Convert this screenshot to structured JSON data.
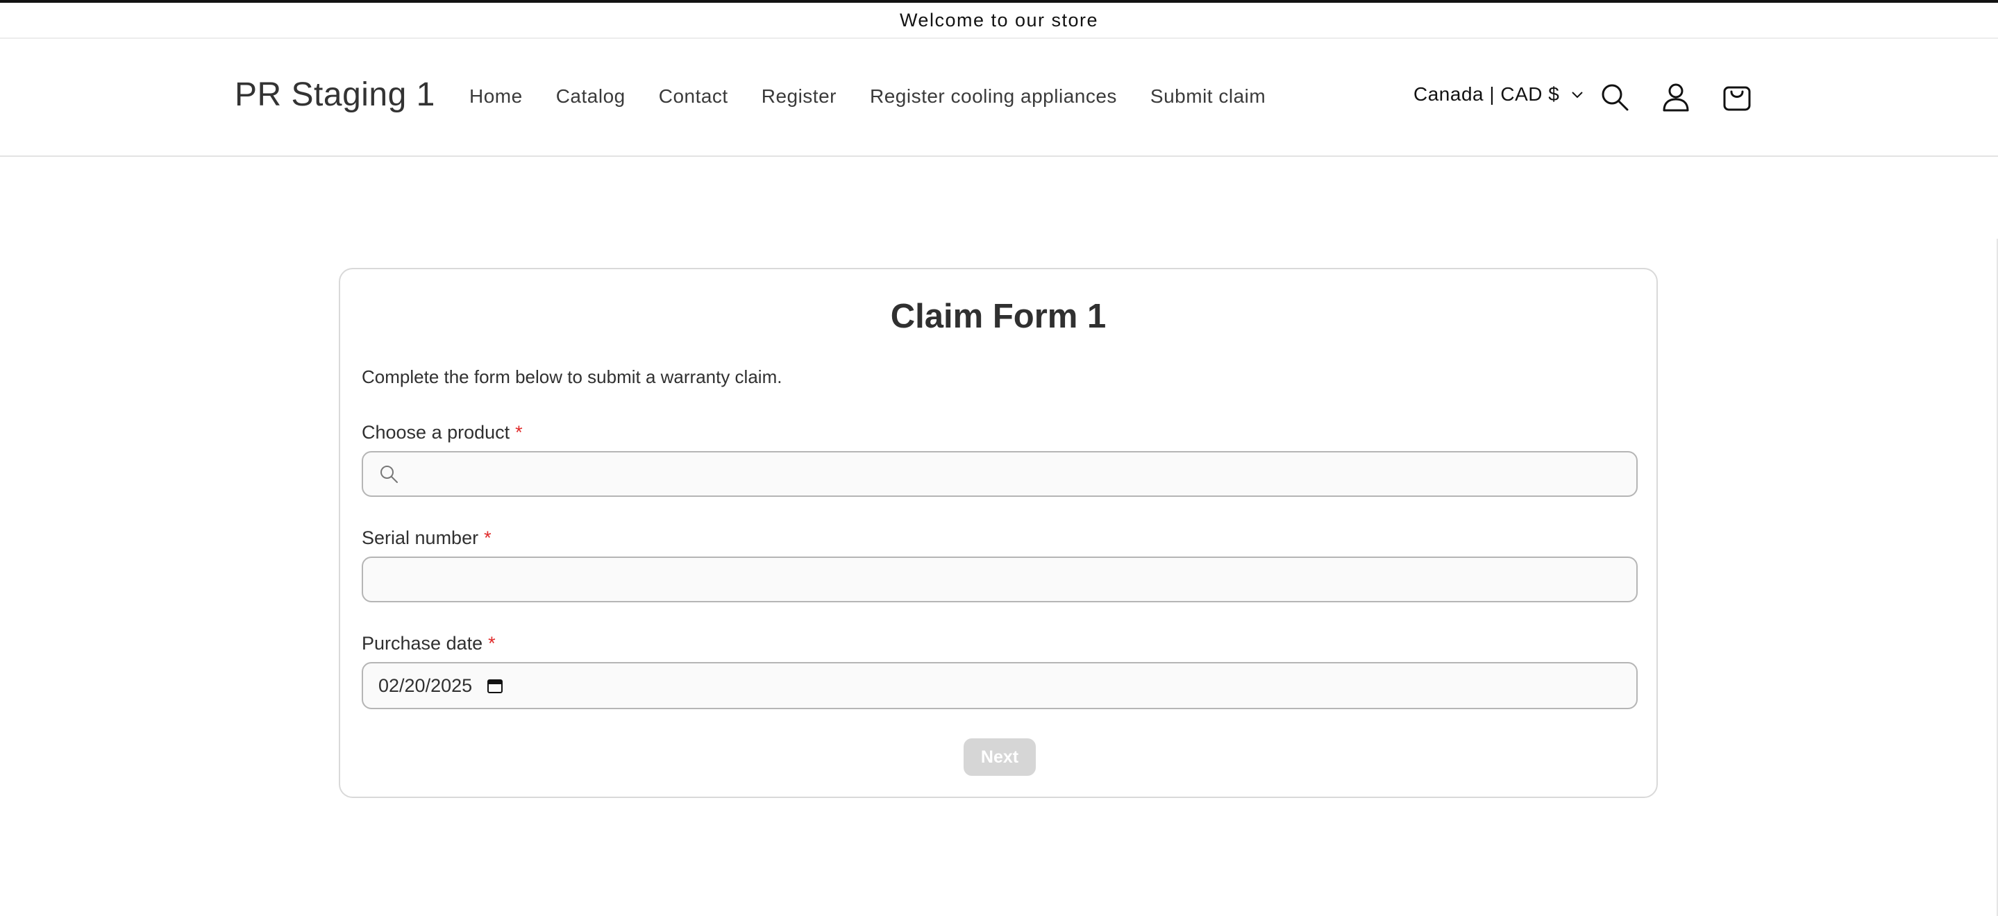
{
  "announcement": {
    "text": "Welcome to our store"
  },
  "header": {
    "logo": "PR Staging 1",
    "nav": [
      {
        "label": "Home"
      },
      {
        "label": "Catalog"
      },
      {
        "label": "Contact"
      },
      {
        "label": "Register"
      },
      {
        "label": "Register cooling appliances"
      },
      {
        "label": "Submit claim"
      }
    ],
    "locale": "Canada | CAD $",
    "icons": {
      "search": "search-icon",
      "account": "account-icon",
      "cart": "cart-icon"
    }
  },
  "form": {
    "title": "Claim Form 1",
    "description": "Complete the form below to submit a warranty claim.",
    "required_marker": "*",
    "fields": {
      "product": {
        "label": "Choose a product",
        "value": ""
      },
      "serial": {
        "label": "Serial number",
        "value": ""
      },
      "purchase_date": {
        "label": "Purchase date",
        "value": "02/20/2025"
      }
    },
    "next_label": "Next"
  },
  "colors": {
    "required": "#e02b2b",
    "button_disabled": "#d6d6d6",
    "border": "#b5b5b5"
  }
}
